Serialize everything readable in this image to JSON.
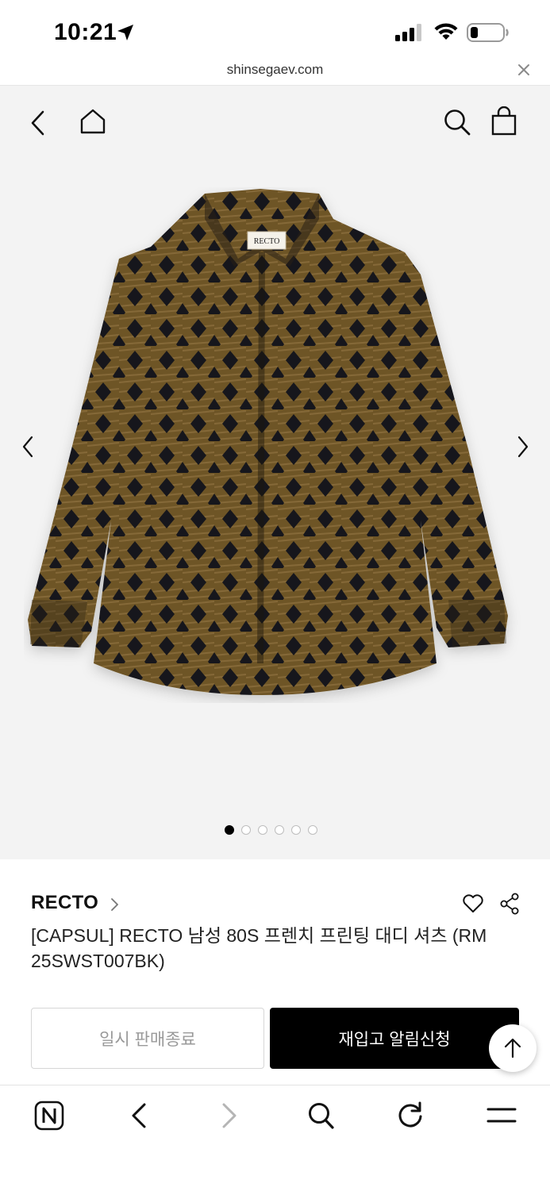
{
  "status_bar": {
    "time": "10:21",
    "icons": [
      "location-arrow-icon",
      "signal-icon",
      "wifi-icon",
      "battery-icon"
    ]
  },
  "browser": {
    "url": "shinsegaev.com",
    "close_icon": "close-icon"
  },
  "product_nav": {
    "icons": [
      "back-icon",
      "home-icon",
      "search-icon",
      "shopping-bag-icon"
    ]
  },
  "gallery": {
    "total_images": 6,
    "current_index": 1,
    "image_label": "RECTO"
  },
  "product": {
    "brand": "RECTO",
    "title": "[CAPSUL] RECTO 남성 80S 프렌치 프린팅 대디 셔츠 (RM25SWST007BK)",
    "title_line1": "[CAPSUL] RECTO 남성 80S 프렌치 프린팅 대디 셔츠 (RM",
    "title_line2": "25SWST007BK)"
  },
  "actions": {
    "soldout_label": "일시 판매종료",
    "restock_label": "재입고 알림신청"
  },
  "toolbar": {
    "icons": [
      "naver-icon",
      "back-icon",
      "forward-icon",
      "search-icon",
      "reload-icon",
      "menu-icon"
    ]
  },
  "colors": {
    "accent": "#000000",
    "hero_bg": "#f3f3f3",
    "disabled_text": "#999999"
  }
}
